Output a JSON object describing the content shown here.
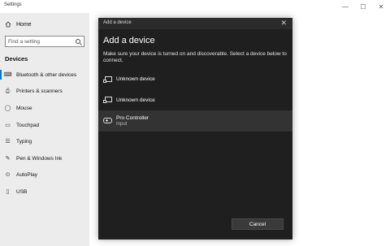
{
  "window": {
    "title": "Settings",
    "controls": {
      "minimize": "—",
      "maximize": "☐",
      "close": "✕"
    }
  },
  "sidebar": {
    "home_label": "Home",
    "search_placeholder": "Find a setting",
    "section_title": "Devices",
    "items": [
      {
        "label": "Bluetooth & other devices",
        "icon": "bluetooth-devices-icon",
        "active": true
      },
      {
        "label": "Printers & scanners",
        "icon": "printer-icon",
        "active": false
      },
      {
        "label": "Mouse",
        "icon": "mouse-icon",
        "active": false
      },
      {
        "label": "Touchpad",
        "icon": "touchpad-icon",
        "active": false
      },
      {
        "label": "Typing",
        "icon": "keyboard-icon",
        "active": false
      },
      {
        "label": "Pen & Windows Ink",
        "icon": "pen-icon",
        "active": false
      },
      {
        "label": "AutoPlay",
        "icon": "autoplay-icon",
        "active": false
      },
      {
        "label": "USB",
        "icon": "usb-icon",
        "active": false
      }
    ]
  },
  "dialog": {
    "window_title": "Add a device",
    "close_glyph": "✕",
    "heading": "Add a device",
    "description": "Make sure your device is turned on and discoverable. Select a device below to connect.",
    "devices": [
      {
        "name": "Unknown device",
        "subtitle": "",
        "icon": "display-device-icon"
      },
      {
        "name": "Unknown device",
        "subtitle": "",
        "icon": "display-device-icon"
      },
      {
        "name": "Pro Controller",
        "subtitle": "Input",
        "icon": "gamepad-icon"
      }
    ],
    "cancel_label": "Cancel"
  },
  "colors": {
    "accent": "#0078d4",
    "dialog_bg": "#1f1f1f",
    "sidebar_bg": "#ececec"
  }
}
